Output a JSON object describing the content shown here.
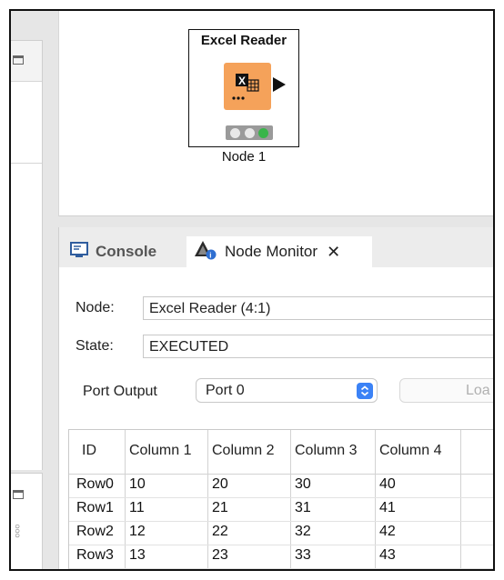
{
  "node": {
    "title": "Excel Reader",
    "label": "Node 1",
    "icon": "excel-reader-icon",
    "icon_color": "#f5a25a",
    "status": "executed"
  },
  "tabs": [
    {
      "label": "Console",
      "icon": "console-icon"
    },
    {
      "label": "Node Monitor",
      "icon": "node-monitor-icon",
      "active": true
    }
  ],
  "monitor": {
    "node_label": "Node:",
    "node_value": "Excel Reader  (4:1)",
    "state_label": "State:",
    "state_value": "EXECUTED",
    "port_label": "Port Output",
    "port_value": "Port 0",
    "load_label": "Loa"
  },
  "table": {
    "columns": [
      "ID",
      "Column 1",
      "Column 2",
      "Column 3",
      "Column 4"
    ],
    "rows": [
      [
        "Row0",
        "10",
        "20",
        "30",
        "40"
      ],
      [
        "Row1",
        "11",
        "21",
        "31",
        "41"
      ],
      [
        "Row2",
        "12",
        "22",
        "32",
        "42"
      ],
      [
        "Row3",
        "13",
        "23",
        "33",
        "43"
      ]
    ]
  },
  "colors": {
    "accent": "#3b82f6",
    "status_green": "#39b54a"
  }
}
